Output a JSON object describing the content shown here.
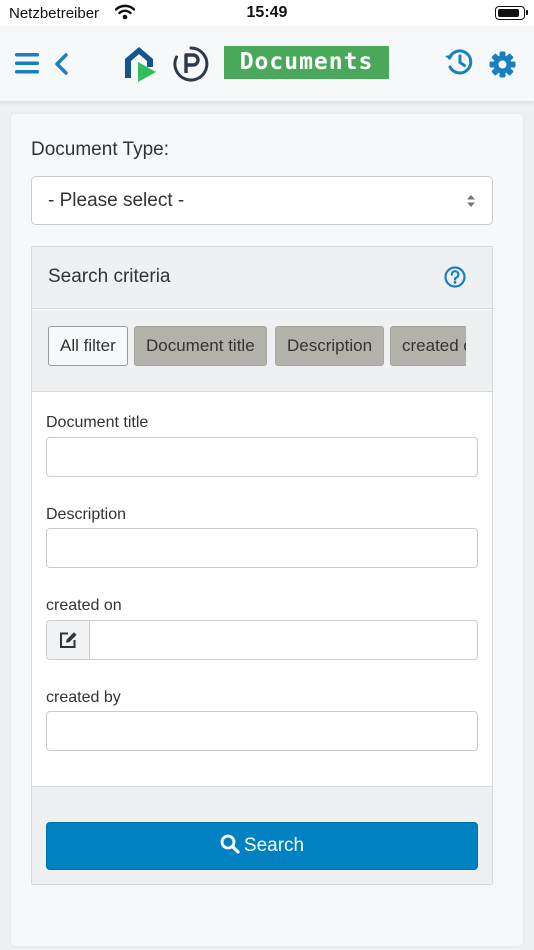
{
  "status_bar": {
    "carrier": "Netzbetreiber",
    "time": "15:49",
    "battery_level": 0.9
  },
  "nav": {
    "title": "Documents",
    "icons": [
      "menu-icon",
      "back-chevron-icon",
      "app-logo",
      "parking-logo",
      "history-icon",
      "settings-icon"
    ]
  },
  "form": {
    "document_type_label": "Document Type:",
    "document_type_value": "- Please select -"
  },
  "search_criteria": {
    "title": "Search criteria",
    "filters": [
      "All filter",
      "Document title",
      "Description",
      "created on"
    ],
    "active_filter": "All filter",
    "fields": [
      {
        "label": "Document title",
        "value": ""
      },
      {
        "label": "Description",
        "value": ""
      },
      {
        "label": "created on",
        "value": ""
      },
      {
        "label": "created by",
        "value": ""
      }
    ],
    "search_button": "Search"
  },
  "colors": {
    "accent_blue": "#0081c2",
    "brand_green": "#4aa85a",
    "chip_gray": "#b3b2aa"
  }
}
